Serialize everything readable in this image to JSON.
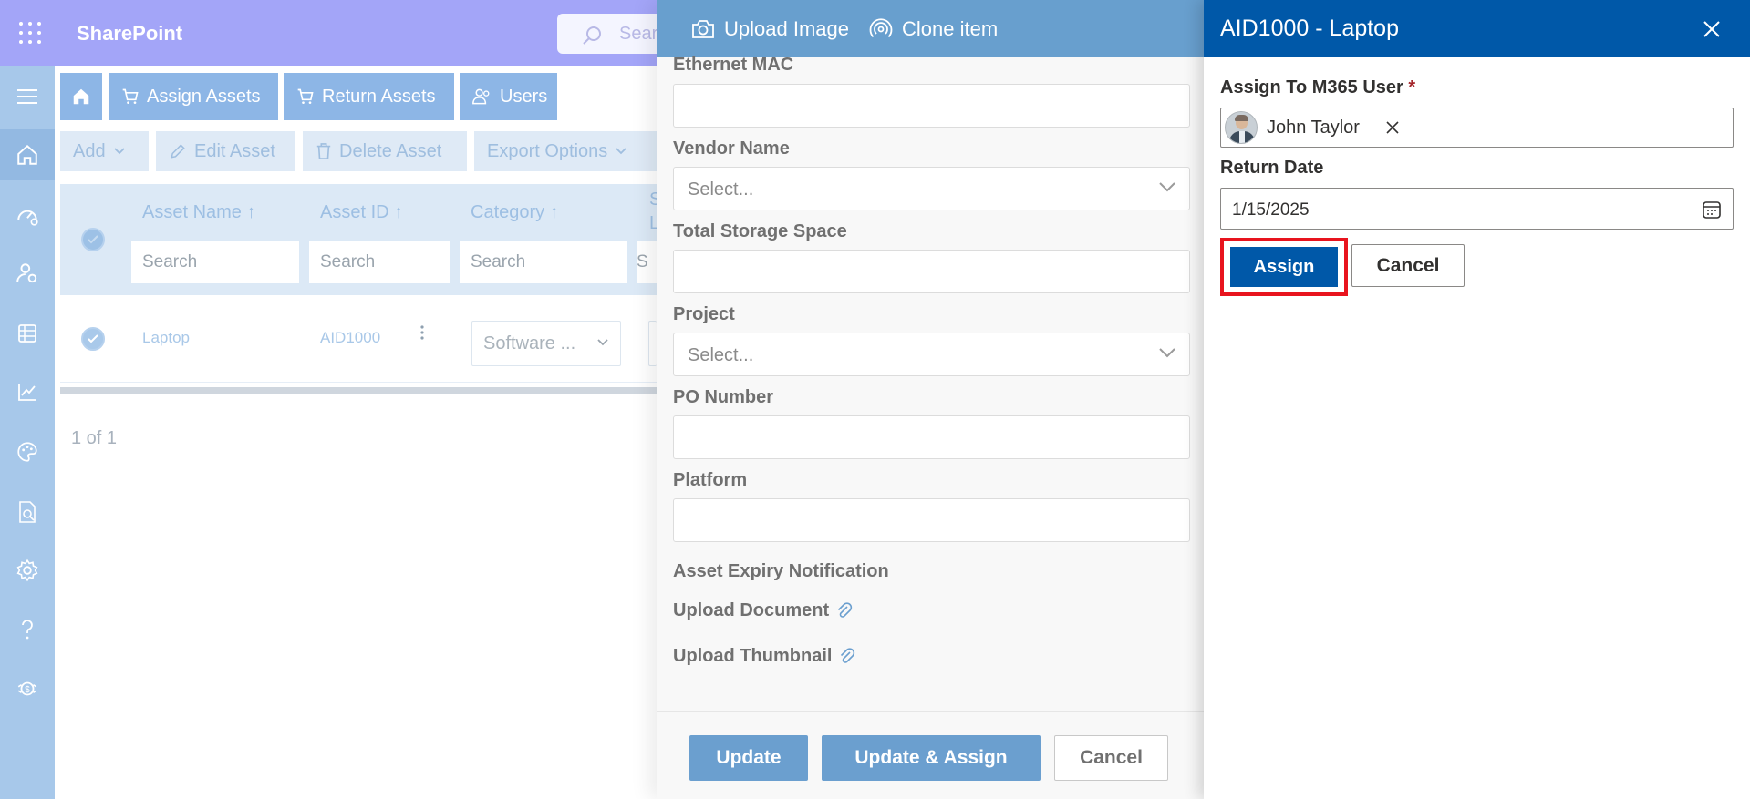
{
  "app": {
    "title": "SharePoint",
    "search_placeholder": "Sear"
  },
  "background": {
    "tabs": [
      {
        "label": "Assign Assets",
        "icon": "cart-icon"
      },
      {
        "label": "Return Assets",
        "icon": "cart-icon"
      },
      {
        "label": "Users",
        "icon": "people-icon"
      }
    ],
    "commands": [
      {
        "label": "Add",
        "icon": "chevron-down-icon"
      },
      {
        "label": "Edit Asset",
        "icon": "pencil-icon"
      },
      {
        "label": "Delete Asset",
        "icon": "trash-icon"
      },
      {
        "label": "Export Options",
        "icon": "chevron-down-icon"
      }
    ],
    "columns": [
      {
        "label": "Asset Name ↑",
        "search": "Search"
      },
      {
        "label": "Asset ID ↑",
        "search": "Search"
      },
      {
        "label": "Category ↑",
        "search": "Search"
      },
      {
        "label": "S",
        "label2": "L",
        "search": "S"
      }
    ],
    "row": {
      "asset_name": "Laptop",
      "asset_id": "AID1000",
      "category": "Software ..."
    },
    "pager": "1 of 1"
  },
  "edit_panel": {
    "header_buttons": [
      {
        "label": "Upload Image",
        "icon": "camera-icon"
      },
      {
        "label": "Clone item",
        "icon": "broadcast-icon"
      }
    ],
    "fields": {
      "ethernet_mac": "Ethernet MAC",
      "vendor_name": "Vendor Name",
      "vendor_placeholder": "Select...",
      "total_storage": "Total Storage Space",
      "project": "Project",
      "project_placeholder": "Select...",
      "po_number": "PO Number",
      "platform": "Platform",
      "expiry": "Asset Expiry Notification",
      "upload_document": "Upload Document",
      "upload_thumbnail": "Upload Thumbnail"
    },
    "footer": {
      "update": "Update",
      "update_assign": "Update & Assign",
      "cancel": "Cancel"
    }
  },
  "assign_panel": {
    "title": "AID1000 - Laptop",
    "assign_to_label": "Assign To M365 User",
    "required_marker": "*",
    "selected_user": "John Taylor",
    "return_date_label": "Return Date",
    "return_date_value": "1/15/2025",
    "assign_button": "Assign",
    "cancel_button": "Cancel"
  },
  "colors": {
    "topbar": "#a3a5f8",
    "panel_header": "#0058a8",
    "edit_header": "#689fce",
    "highlight": "#e8141e"
  }
}
